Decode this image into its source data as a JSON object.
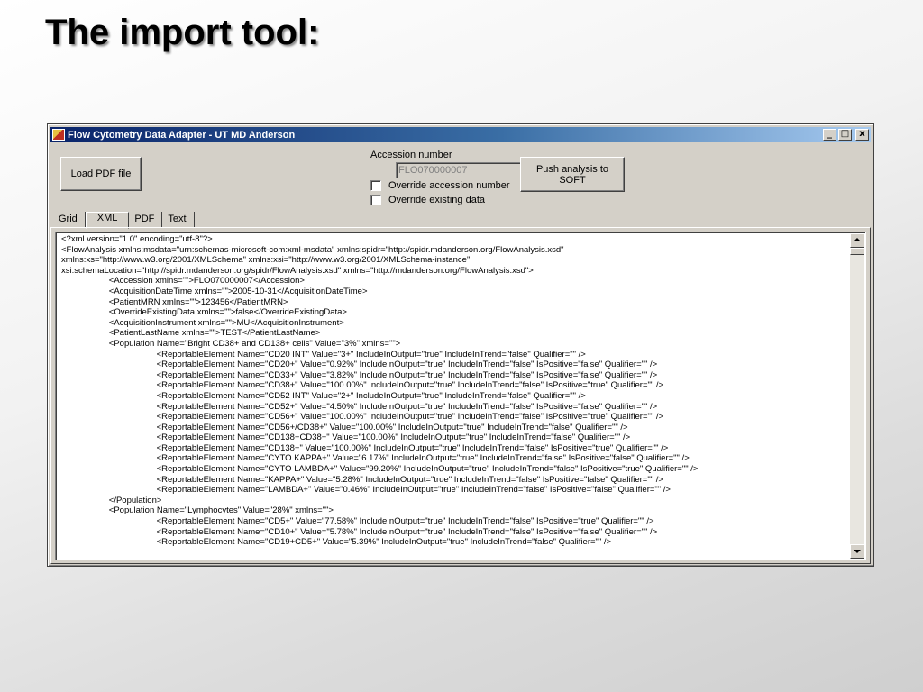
{
  "slide": {
    "title": "The import tool:"
  },
  "window": {
    "title": "Flow Cytometry Data Adapter - UT MD Anderson",
    "minimize": "_",
    "maximize": "□",
    "close": "x"
  },
  "toolbar": {
    "load_pdf_label": "Load PDF file",
    "accession_label": "Accession number",
    "accession_value": "FLO070000007",
    "override_accession_label": "Override accession number",
    "override_existing_label": "Override existing data",
    "push_label_line1": "Push analysis to",
    "push_label_line2": "SOFT"
  },
  "tabs": [
    "Grid",
    "XML",
    "PDF",
    "Text"
  ],
  "active_tab": "XML",
  "xml_lines": [
    "<?xml version=\"1.0\" encoding=\"utf-8\"?>",
    "<FlowAnalysis xmlns:msdata=\"urn:schemas-microsoft-com:xml-msdata\" xmlns:spidr=\"http://spidr.mdanderson.org/FlowAnalysis.xsd\"",
    "xmlns:xs=\"http://www.w3.org/2001/XMLSchema\" xmlns:xsi=\"http://www.w3.org/2001/XMLSchema-instance\"",
    "xsi:schemaLocation=\"http://spidr.mdanderson.org/spidr/FlowAnalysis.xsd\" xmlns=\"http://mdanderson.org/FlowAnalysis.xsd\">",
    "                    <Accession xmlns=\"\">FLO070000007</Accession>",
    "                    <AcquisitionDateTime xmlns=\"\">2005-10-31</AcquisitionDateTime>",
    "                    <PatientMRN xmlns=\"\">123456</PatientMRN>",
    "                    <OverrideExistingData xmlns=\"\">false</OverrideExistingData>",
    "                    <AcquisitionInstrument xmlns=\"\">MU</AcquisitionInstrument>",
    "                    <PatientLastName xmlns=\"\">TEST</PatientLastName>",
    "                    <Population Name=\"Bright CD38+ and CD138+ cells\" Value=\"3%\" xmlns=\"\">",
    "                                        <ReportableElement Name=\"CD20 INT\" Value=\"3+\" IncludeInOutput=\"true\" IncludeInTrend=\"false\" Qualifier=\"\" />",
    "                                        <ReportableElement Name=\"CD20+\" Value=\"0.92%\" IncludeInOutput=\"true\" IncludeInTrend=\"false\" IsPositive=\"false\" Qualifier=\"\" />",
    "                                        <ReportableElement Name=\"CD33+\" Value=\"3.82%\" IncludeInOutput=\"true\" IncludeInTrend=\"false\" IsPositive=\"false\" Qualifier=\"\" />",
    "                                        <ReportableElement Name=\"CD38+\" Value=\"100.00%\" IncludeInOutput=\"true\" IncludeInTrend=\"false\" IsPositive=\"true\" Qualifier=\"\" />",
    "                                        <ReportableElement Name=\"CD52 INT\" Value=\"2+\" IncludeInOutput=\"true\" IncludeInTrend=\"false\" Qualifier=\"\" />",
    "                                        <ReportableElement Name=\"CD52+\" Value=\"4.50%\" IncludeInOutput=\"true\" IncludeInTrend=\"false\" IsPositive=\"false\" Qualifier=\"\" />",
    "                                        <ReportableElement Name=\"CD56+\" Value=\"100.00%\" IncludeInOutput=\"true\" IncludeInTrend=\"false\" IsPositive=\"true\" Qualifier=\"\" />",
    "                                        <ReportableElement Name=\"CD56+/CD38+\" Value=\"100.00%\" IncludeInOutput=\"true\" IncludeInTrend=\"false\" Qualifier=\"\" />",
    "                                        <ReportableElement Name=\"CD138+CD38+\" Value=\"100.00%\" IncludeInOutput=\"true\" IncludeInTrend=\"false\" Qualifier=\"\" />",
    "                                        <ReportableElement Name=\"CD138+\" Value=\"100.00%\" IncludeInOutput=\"true\" IncludeInTrend=\"false\" IsPositive=\"true\" Qualifier=\"\" />",
    "                                        <ReportableElement Name=\"CYTO KAPPA+\" Value=\"6.17%\" IncludeInOutput=\"true\" IncludeInTrend=\"false\" IsPositive=\"false\" Qualifier=\"\" />",
    "                                        <ReportableElement Name=\"CYTO LAMBDA+\" Value=\"99.20%\" IncludeInOutput=\"true\" IncludeInTrend=\"false\" IsPositive=\"true\" Qualifier=\"\" />",
    "                                        <ReportableElement Name=\"KAPPA+\" Value=\"5.28%\" IncludeInOutput=\"true\" IncludeInTrend=\"false\" IsPositive=\"false\" Qualifier=\"\" />",
    "                                        <ReportableElement Name=\"LAMBDA+\" Value=\"0.46%\" IncludeInOutput=\"true\" IncludeInTrend=\"false\" IsPositive=\"false\" Qualifier=\"\" />",
    "                    </Population>",
    "                    <Population Name=\"Lymphocytes\" Value=\"28%\" xmlns=\"\">",
    "                                        <ReportableElement Name=\"CD5+\" Value=\"77.58%\" IncludeInOutput=\"true\" IncludeInTrend=\"false\" IsPositive=\"true\" Qualifier=\"\" />",
    "                                        <ReportableElement Name=\"CD10+\" Value=\"5.78%\" IncludeInOutput=\"true\" IncludeInTrend=\"false\" IsPositive=\"false\" Qualifier=\"\" />",
    "                                        <ReportableElement Name=\"CD19+CD5+\" Value=\"5.39%\" IncludeInOutput=\"true\" IncludeInTrend=\"false\" Qualifier=\"\" />"
  ]
}
